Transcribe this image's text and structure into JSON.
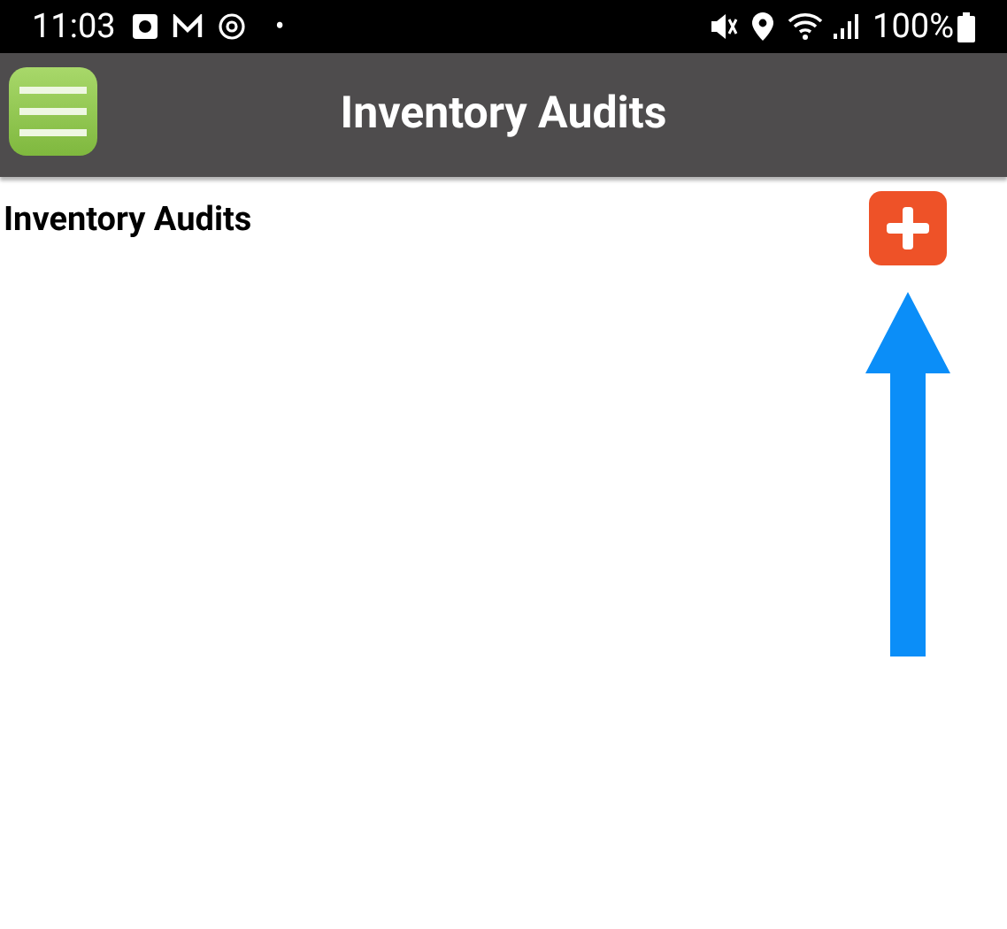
{
  "status_bar": {
    "time": "11:03",
    "dot": "•",
    "battery": "100%"
  },
  "header": {
    "title": "Inventory Audits"
  },
  "section": {
    "title": "Inventory Audits"
  }
}
